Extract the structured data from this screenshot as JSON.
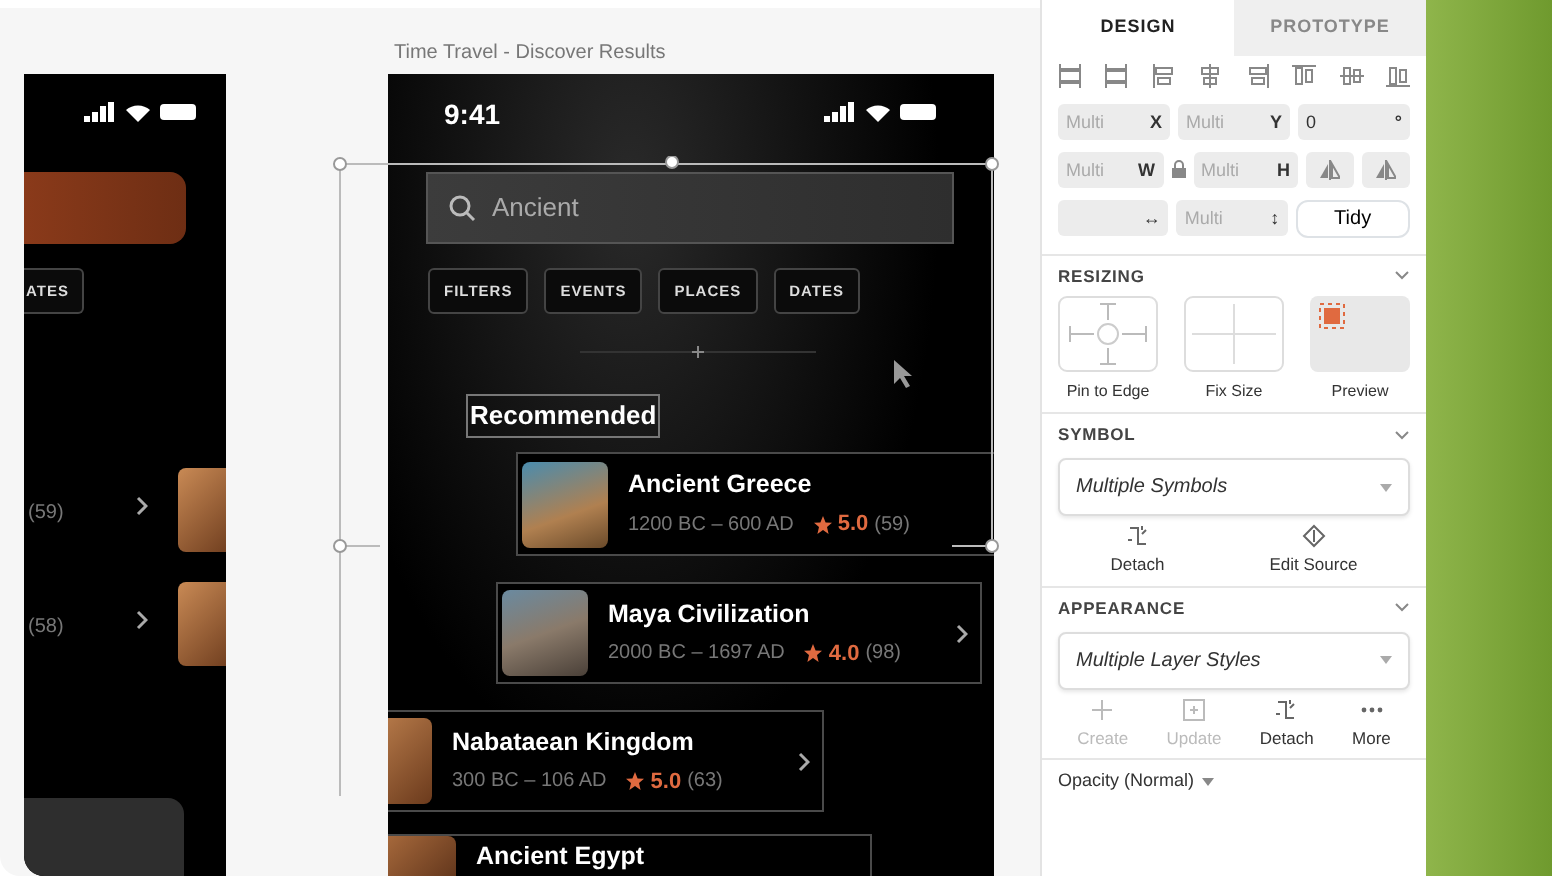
{
  "left_artboard": {
    "chip": "ATES",
    "rows": [
      {
        "count": "(59)"
      },
      {
        "count": "(58)"
      }
    ]
  },
  "main_artboard": {
    "title": "Time Travel - Discover Results",
    "time": "9:41",
    "search": {
      "value": "Ancient"
    },
    "chips": [
      "FILTERS",
      "EVENTS",
      "PLACES",
      "DATES"
    ],
    "section_title": "Recommended",
    "cards": [
      {
        "title": "Ancient Greece",
        "dates": "1200 BC – 600 AD",
        "rating": "5.0",
        "count": "(59)",
        "chevron": false
      },
      {
        "title": "Maya Civilization",
        "dates": "2000 BC – 1697 AD",
        "rating": "4.0",
        "count": "(98)",
        "chevron": true
      },
      {
        "title": "Nabataean Kingdom",
        "dates": "300 BC – 106 AD",
        "rating": "5.0",
        "count": "(63)",
        "chevron": true
      },
      {
        "title": "Ancient Egypt",
        "chevron": false
      }
    ]
  },
  "inspector": {
    "tabs": [
      {
        "label": "DESIGN",
        "selected": true
      },
      {
        "label": "PROTOTYPE",
        "selected": false
      }
    ],
    "geometry_rows": [
      [
        {
          "kind": "field",
          "placeholder": "Multi",
          "suffix": "X"
        },
        {
          "kind": "field",
          "placeholder": "Multi",
          "suffix": "Y"
        },
        {
          "kind": "field",
          "value": "0",
          "suffix": "°"
        }
      ],
      [
        {
          "kind": "field",
          "placeholder": "Multi",
          "suffix": "W"
        },
        {
          "kind": "lock"
        },
        {
          "kind": "field",
          "placeholder": "Multi",
          "suffix": "H"
        },
        {
          "kind": "flip"
        },
        {
          "kind": "flip"
        }
      ],
      [
        {
          "kind": "field",
          "suffix": "↔"
        },
        {
          "kind": "field",
          "placeholder": "Multi",
          "suffix": "↕"
        },
        {
          "kind": "button",
          "label": "Tidy"
        }
      ]
    ],
    "resizing": {
      "title": "RESIZING",
      "expanded": true,
      "options": [
        {
          "kind": "pin",
          "label": "Pin to Edge"
        },
        {
          "kind": "fix",
          "label": "Fix Size"
        },
        {
          "kind": "preview",
          "label": "Preview"
        }
      ]
    },
    "symbol": {
      "title": "SYMBOL",
      "expanded": true,
      "dropdown": "Multiple Symbols",
      "actions": [
        {
          "kind": "detach",
          "label": "Detach",
          "disabled": false
        },
        {
          "kind": "source",
          "label": "Edit Source",
          "disabled": false
        }
      ]
    },
    "appearance": {
      "title": "APPEARANCE",
      "expanded": true,
      "dropdown": "Multiple Layer Styles",
      "actions": [
        {
          "kind": "create",
          "label": "Create",
          "disabled": true
        },
        {
          "kind": "update",
          "label": "Update",
          "disabled": true
        },
        {
          "kind": "detach",
          "label": "Detach",
          "disabled": false
        },
        {
          "kind": "more",
          "label": "More",
          "disabled": false
        }
      ]
    },
    "opacity_label": "Opacity (Normal)"
  }
}
